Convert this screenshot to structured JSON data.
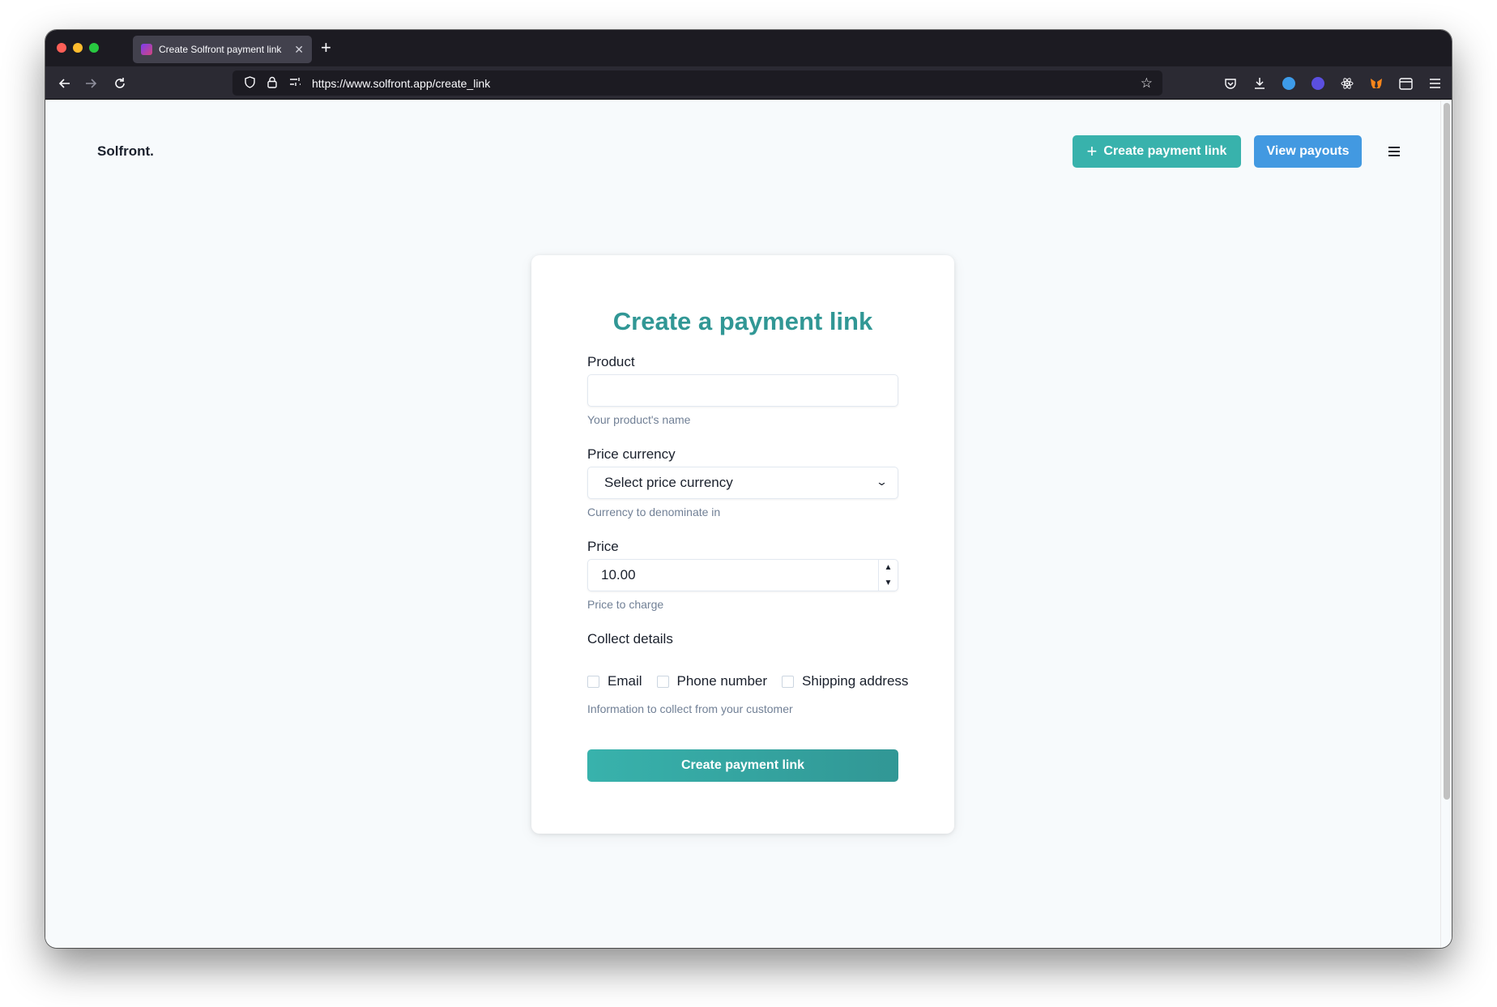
{
  "browser": {
    "tab_title": "Create Solfront payment link",
    "tab_close": "✕",
    "new_tab": "+",
    "url": "https://www.solfront.app/create_link"
  },
  "header": {
    "brand": "Solfront.",
    "create_button": "Create payment link",
    "payouts_button": "View payouts"
  },
  "form": {
    "title": "Create a payment link",
    "product": {
      "label": "Product",
      "value": "",
      "help": "Your product's name"
    },
    "currency": {
      "label": "Price currency",
      "selected": "Select price currency",
      "help": "Currency to denominate in"
    },
    "price": {
      "label": "Price",
      "value": "10.00",
      "help": "Price to charge"
    },
    "collect": {
      "label": "Collect details",
      "options": [
        "Email",
        "Phone number",
        "Shipping address"
      ],
      "help": "Information to collect from your customer"
    },
    "submit": "Create payment link"
  },
  "colors": {
    "teal": "#38b2ac",
    "teal_dark": "#319795",
    "blue": "#4299e1",
    "page_bg": "#f7fafc"
  },
  "icons": {
    "back": "back-arrow-icon",
    "forward": "forward-arrow-icon",
    "reload": "reload-icon",
    "shield": "shield-icon",
    "lock": "lock-icon",
    "bookmark": "star-icon",
    "menu": "hamburger-icon"
  }
}
